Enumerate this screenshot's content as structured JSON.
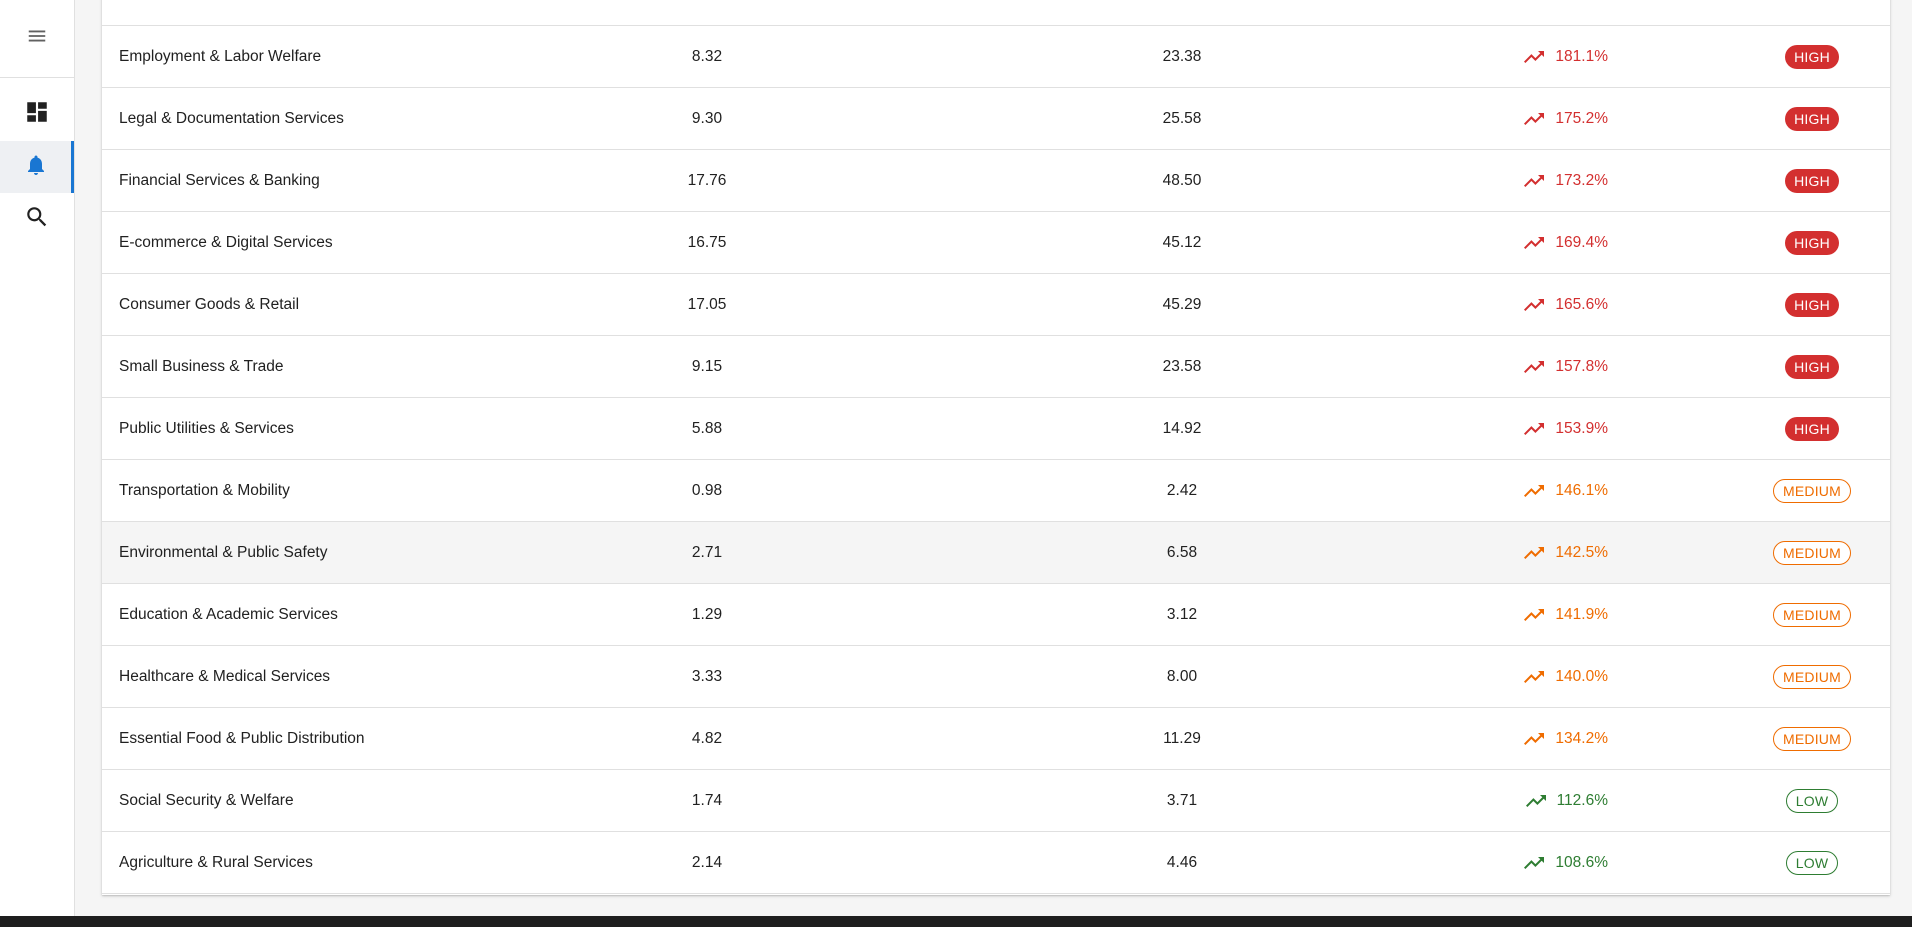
{
  "colors": {
    "high": "#d32f2f",
    "medium": "#ef6c00",
    "low": "#2e7d32",
    "accent": "#1976d2"
  },
  "sidebar": {
    "menu_icon": "menu-icon",
    "items": [
      {
        "icon": "dashboard-icon",
        "active": false
      },
      {
        "icon": "bell-icon",
        "active": true
      },
      {
        "icon": "search-icon",
        "active": false
      }
    ]
  },
  "table": {
    "rows": [
      {
        "name": "Employment & Labor Welfare",
        "before": "8.32",
        "after": "23.38",
        "change": "181.1%",
        "risk": "HIGH",
        "level": "high"
      },
      {
        "name": "Legal & Documentation Services",
        "before": "9.30",
        "after": "25.58",
        "change": "175.2%",
        "risk": "HIGH",
        "level": "high"
      },
      {
        "name": "Financial Services & Banking",
        "before": "17.76",
        "after": "48.50",
        "change": "173.2%",
        "risk": "HIGH",
        "level": "high"
      },
      {
        "name": "E-commerce & Digital Services",
        "before": "16.75",
        "after": "45.12",
        "change": "169.4%",
        "risk": "HIGH",
        "level": "high"
      },
      {
        "name": "Consumer Goods & Retail",
        "before": "17.05",
        "after": "45.29",
        "change": "165.6%",
        "risk": "HIGH",
        "level": "high"
      },
      {
        "name": "Small Business & Trade",
        "before": "9.15",
        "after": "23.58",
        "change": "157.8%",
        "risk": "HIGH",
        "level": "high"
      },
      {
        "name": "Public Utilities & Services",
        "before": "5.88",
        "after": "14.92",
        "change": "153.9%",
        "risk": "HIGH",
        "level": "high"
      },
      {
        "name": "Transportation & Mobility",
        "before": "0.98",
        "after": "2.42",
        "change": "146.1%",
        "risk": "MEDIUM",
        "level": "medium"
      },
      {
        "name": "Environmental & Public Safety",
        "before": "2.71",
        "after": "6.58",
        "change": "142.5%",
        "risk": "MEDIUM",
        "level": "medium"
      },
      {
        "name": "Education & Academic Services",
        "before": "1.29",
        "after": "3.12",
        "change": "141.9%",
        "risk": "MEDIUM",
        "level": "medium"
      },
      {
        "name": "Healthcare & Medical Services",
        "before": "3.33",
        "after": "8.00",
        "change": "140.0%",
        "risk": "MEDIUM",
        "level": "medium"
      },
      {
        "name": "Essential Food & Public Distribution",
        "before": "4.82",
        "after": "11.29",
        "change": "134.2%",
        "risk": "MEDIUM",
        "level": "medium"
      },
      {
        "name": "Social Security & Welfare",
        "before": "1.74",
        "after": "3.71",
        "change": "112.6%",
        "risk": "LOW",
        "level": "low"
      },
      {
        "name": "Agriculture & Rural Services",
        "before": "2.14",
        "after": "4.46",
        "change": "108.6%",
        "risk": "LOW",
        "level": "low"
      }
    ]
  }
}
